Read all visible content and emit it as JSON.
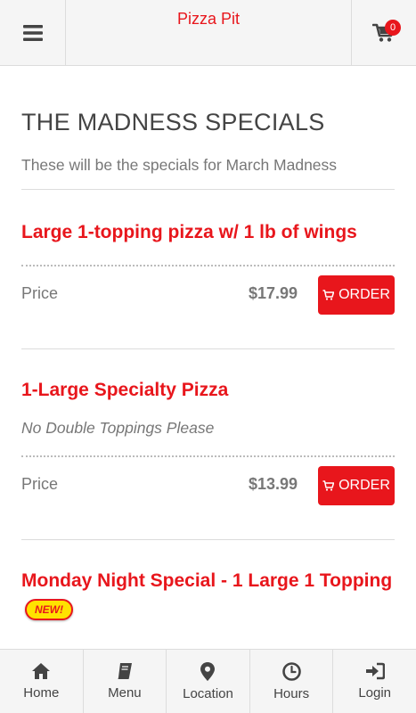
{
  "header": {
    "title": "Pizza Pit",
    "cart_count": "0",
    "menu_icon": "hamburger-icon",
    "cart_icon": "shopping-cart-icon"
  },
  "category": {
    "title": "THE MADNESS SPECIALS",
    "description": "These will be the specials for March Madness"
  },
  "items": [
    {
      "name": "Large 1-topping pizza w/ 1 lb of wings",
      "price_label": "Price",
      "price": "$17.99",
      "order_label": "ORDER"
    },
    {
      "name": "1-Large Specialty Pizza",
      "description": "No Double Toppings Please",
      "price_label": "Price",
      "price": "$13.99",
      "order_label": "ORDER"
    },
    {
      "name": "Monday Night Special - 1 Large 1 Topping",
      "badge": "NEW!"
    }
  ],
  "bottom_nav": [
    {
      "label": "Home",
      "icon": "home-icon"
    },
    {
      "label": "Menu",
      "icon": "book-icon"
    },
    {
      "label": "Location",
      "icon": "map-marker-icon"
    },
    {
      "label": "Hours",
      "icon": "clock-icon"
    },
    {
      "label": "Login",
      "icon": "sign-in-icon"
    }
  ],
  "colors": {
    "accent": "#e8161c",
    "badge_yellow": "#ffe200"
  }
}
